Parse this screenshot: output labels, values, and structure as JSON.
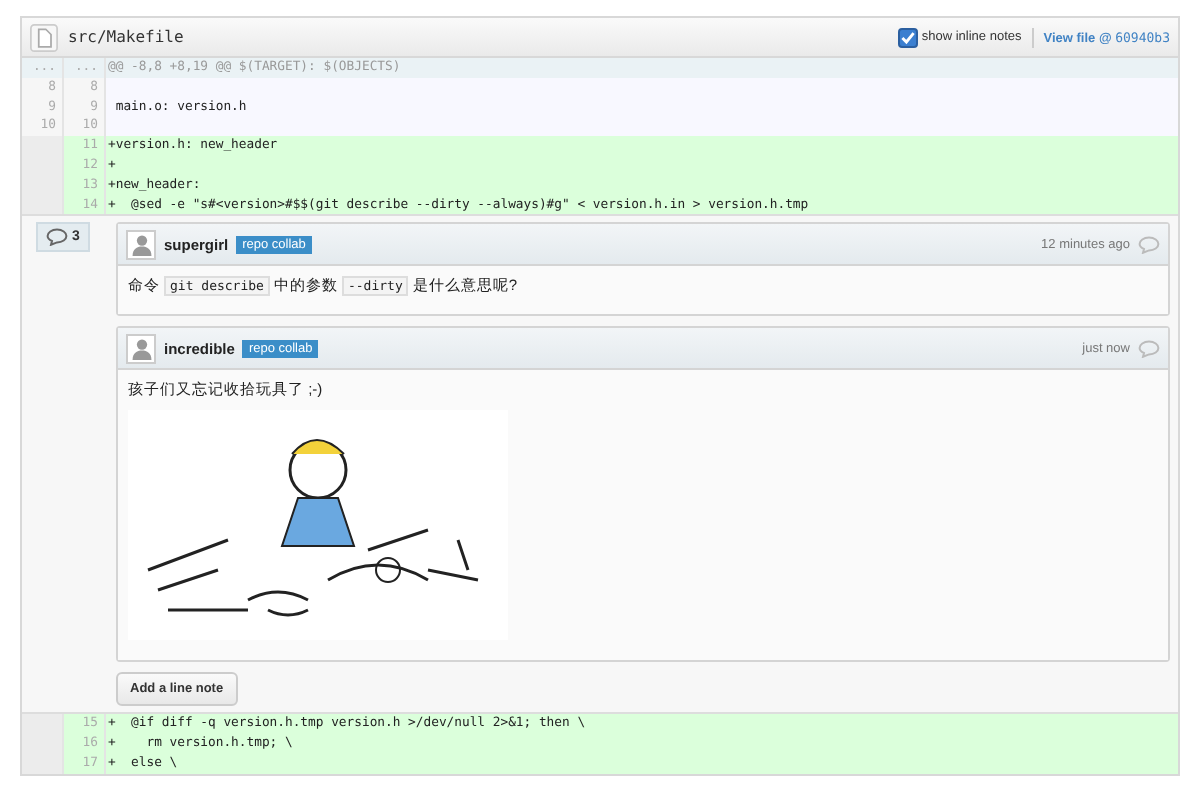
{
  "file": {
    "path": "src/Makefile",
    "show_inline_notes": {
      "label": "show inline notes",
      "checked": true
    },
    "view_file": {
      "label": "View file @",
      "sha": "60940b3"
    }
  },
  "lines": [
    {
      "kind": "hunk",
      "old": "...",
      "new": "...",
      "text": "@@ -8,8 +8,19 @@ $(TARGET): $(OBJECTS)"
    },
    {
      "kind": "context",
      "old": "8",
      "new": "8"
    },
    {
      "kind": "context",
      "old": "9",
      "new": "9",
      "text": " main.o: version.h"
    },
    {
      "kind": "context",
      "old": "10",
      "new": "10"
    },
    {
      "kind": "add",
      "new": "11",
      "text": "+version.h: new_header"
    },
    {
      "kind": "add",
      "new": "12",
      "text": "+"
    },
    {
      "kind": "add",
      "new": "13",
      "text": "+new_header:"
    },
    {
      "kind": "add",
      "new": "14",
      "text": "+  @sed -e \"s#<version>#$$(git describe --dirty --always)#g\" < version.h.in > version.h.tmp"
    }
  ],
  "notes": {
    "count": "3",
    "comments": [
      {
        "author": "supergirl",
        "badge": "repo collab",
        "time": "12 minutes ago",
        "body": [
          {
            "kind": "text",
            "text": "命令"
          },
          {
            "kind": "code",
            "text": "git describe"
          },
          {
            "kind": "text",
            "text": "中的参数"
          },
          {
            "kind": "code",
            "text": "--dirty"
          },
          {
            "kind": "text",
            "text": "是什么意思呢?"
          }
        ]
      },
      {
        "author": "incredible",
        "badge": "repo collab",
        "time": "just now",
        "body": [
          {
            "kind": "text",
            "text": "孩子们又忘记收拾玩具了 ;-)"
          }
        ],
        "has_image": true
      }
    ],
    "add_button": "Add a line note"
  },
  "lines_after": [
    {
      "kind": "add",
      "new": "15",
      "text": "+  @if diff -q version.h.tmp version.h >/dev/null 2>&1; then \\"
    },
    {
      "kind": "add",
      "new": "16",
      "text": "+    rm version.h.tmp; \\"
    },
    {
      "kind": "add",
      "new": "17",
      "text": "+  else \\"
    }
  ]
}
